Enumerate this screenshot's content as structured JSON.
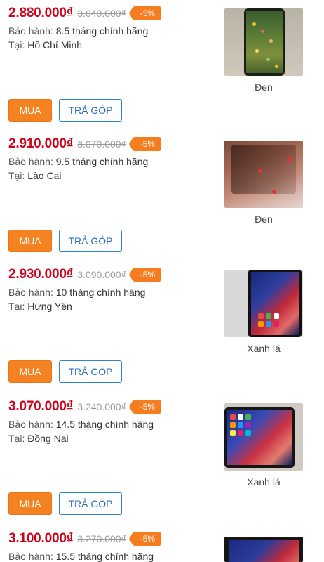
{
  "listings": [
    {
      "price": "2.880.000₫",
      "old_price": "3.040.000₫",
      "discount": "-5%",
      "warranty_label": "Bảo hành:",
      "warranty": "8.5 tháng chính hãng",
      "location_label": "Tại:",
      "location": "Hồ Chí Minh",
      "color": "Đen",
      "buy_label": "MUA",
      "installment_label": "TRẢ GÓP"
    },
    {
      "price": "2.910.000₫",
      "old_price": "3.070.000₫",
      "discount": "-5%",
      "warranty_label": "Bảo hành:",
      "warranty": "9.5 tháng chính hãng",
      "location_label": "Tại:",
      "location": "Lào Cai",
      "color": "Đen",
      "buy_label": "MUA",
      "installment_label": "TRẢ GÓP"
    },
    {
      "price": "2.930.000₫",
      "old_price": "3.090.000₫",
      "discount": "-5%",
      "warranty_label": "Bảo hành:",
      "warranty": "10 tháng chính hãng",
      "location_label": "Tại:",
      "location": "Hưng Yên",
      "color": "Xanh lá",
      "buy_label": "MUA",
      "installment_label": "TRẢ GÓP"
    },
    {
      "price": "3.070.000₫",
      "old_price": "3.240.000₫",
      "discount": "-5%",
      "warranty_label": "Bảo hành:",
      "warranty": "14.5 tháng chính hãng",
      "location_label": "Tại:",
      "location": "Đồng Nai",
      "color": "Xanh lá",
      "buy_label": "MUA",
      "installment_label": "TRẢ GÓP"
    },
    {
      "price": "3.100.000₫",
      "old_price": "3.270.000₫",
      "discount": "-5%",
      "warranty_label": "Bảo hành:",
      "warranty": "15.5 tháng chính hãng"
    }
  ],
  "colors": {
    "price": "#d0021b",
    "badge": "#f57c1f",
    "buy_button": "#f58220",
    "installment_border": "#2a86c9"
  }
}
